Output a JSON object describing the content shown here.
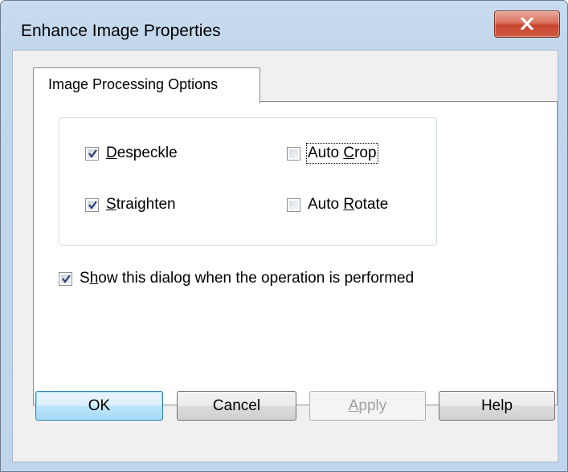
{
  "window": {
    "title": "Enhance Image Properties",
    "close_icon": "close-x-icon"
  },
  "tabs": [
    {
      "label": "Image Processing Options",
      "selected": true
    }
  ],
  "options": {
    "despeckle": {
      "label_mnemonic": "D",
      "label_rest": "especkle",
      "checked": true
    },
    "straighten": {
      "label_mnemonic": "S",
      "label_rest": "traighten",
      "checked": true
    },
    "auto_crop": {
      "label_pre": "Auto ",
      "label_mnemonic": "C",
      "label_rest": "rop",
      "checked": false,
      "focused": true
    },
    "auto_rotate": {
      "label_pre": "Auto ",
      "label_mnemonic": "R",
      "label_rest": "otate",
      "checked": false
    }
  },
  "show_dialog": {
    "label_pre": "S",
    "label_mnemonic": "h",
    "label_rest": "ow this dialog when the operation is performed",
    "checked": true
  },
  "buttons": {
    "ok": "OK",
    "cancel": "Cancel",
    "apply_mnemonic": "A",
    "apply_rest": "pply",
    "apply_enabled": false,
    "help": "Help"
  },
  "colors": {
    "title_bar": "#c2d7ec",
    "close_button": "#c84530",
    "default_button": "#bee6fd",
    "check_mark": "#2a3e6e"
  }
}
